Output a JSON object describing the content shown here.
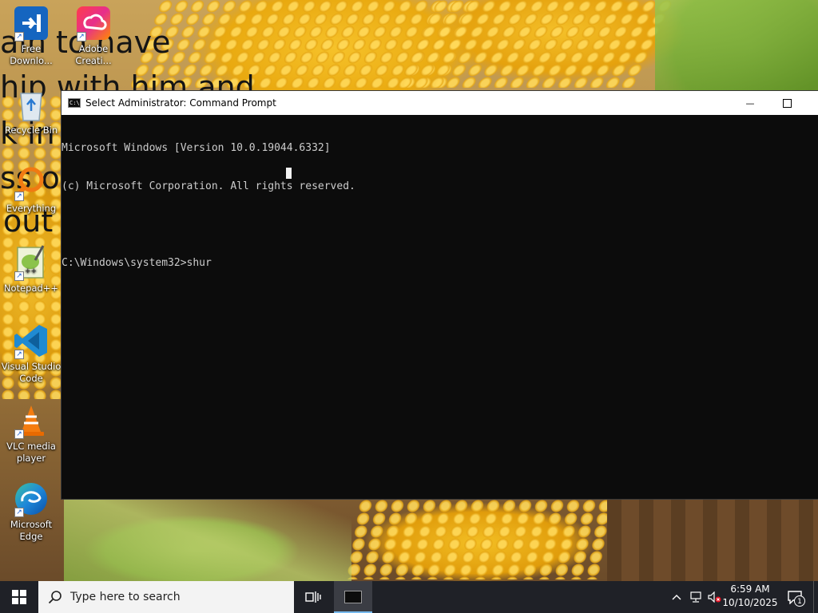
{
  "wallpaper_text": [
    "ain to have",
    "hip with him and",
    "k in th",
    "ss ov",
    "out"
  ],
  "desktop_icons": [
    {
      "label": "Free Downlo...",
      "icon": "free-download-manager-icon"
    },
    {
      "label": "Adobe Creati...",
      "icon": "adobe-creative-cloud-icon"
    },
    {
      "label": "Recycle Bin",
      "icon": "recycle-bin-icon"
    },
    {
      "label": "Everything",
      "icon": "everything-search-icon"
    },
    {
      "label": "Notepad++",
      "icon": "notepad-plus-plus-icon"
    },
    {
      "label": "Visual Studio Code",
      "icon": "vscode-icon"
    },
    {
      "label": "VLC media player",
      "icon": "vlc-icon"
    },
    {
      "label": "Microsoft Edge",
      "icon": "edge-icon"
    }
  ],
  "window": {
    "title": "Select Administrator: Command Prompt",
    "app_icon_text": "C:\\.",
    "minimize_glyph": "—",
    "maximize_glyph": "☐"
  },
  "console": {
    "lines": [
      "Microsoft Windows [Version 10.0.19044.6332]",
      "(c) Microsoft Corporation. All rights reserved.",
      "",
      "C:\\Windows\\system32>shur"
    ]
  },
  "taskbar": {
    "search_placeholder": "Type here to search",
    "time": "6:59 AM",
    "date": "10/10/2025",
    "notification_count": "1"
  },
  "colors": {
    "console_bg": "#0c0c0c",
    "console_text": "#cccccc",
    "taskbar_bg": "#1f2127",
    "active_task_underline": "#76b9ed"
  }
}
